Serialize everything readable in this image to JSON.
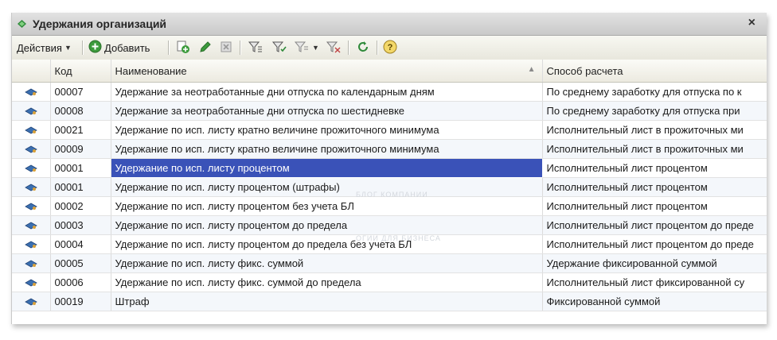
{
  "window": {
    "title": "Удержания организаций",
    "close_glyph": "×"
  },
  "toolbar": {
    "actions_label": "Действия",
    "add_label_first": "Д",
    "add_label_rest": "обавить",
    "icons": [
      "add-copy-icon",
      "edit-pencil-icon",
      "delete-icon",
      "filter-icon",
      "filter-by-value-icon",
      "filter-history-icon",
      "clear-filter-icon",
      "refresh-icon",
      "help-icon"
    ]
  },
  "table": {
    "columns": [
      "",
      "Код",
      "Наименование",
      "Способ расчета"
    ],
    "rows": [
      {
        "code": "00007",
        "name": "Удержание за неотработанные дни отпуска по календарным дням",
        "method": "По среднему заработку для отпуска по к"
      },
      {
        "code": "00008",
        "name": "Удержание за неотработанные дни отпуска по шестидневке",
        "method": "По среднему заработку для отпуска при"
      },
      {
        "code": "00021",
        "name": "Удержание по исп. листу кратно величине прожиточного минимума",
        "method": "Исполнительный лист в прожиточных ми"
      },
      {
        "code": "00009",
        "name": "Удержание по исп. листу кратно величине прожиточного минимума",
        "method": "Исполнительный лист в прожиточных ми"
      },
      {
        "code": "00001",
        "name": "Удержание по исп. листу процентом",
        "method": "Исполнительный лист процентом"
      },
      {
        "code": "00001",
        "name": "Удержание по исп. листу процентом (штрафы)",
        "method": "Исполнительный лист процентом"
      },
      {
        "code": "00002",
        "name": "Удержание по исп. листу процентом без учета БЛ",
        "method": "Исполнительный лист процентом"
      },
      {
        "code": "00003",
        "name": "Удержание по исп. листу процентом до предела",
        "method": "Исполнительный лист процентом до преде"
      },
      {
        "code": "00004",
        "name": "Удержание по исп. листу процентом до предела без учета БЛ",
        "method": "Исполнительный лист процентом до преде"
      },
      {
        "code": "00005",
        "name": "Удержание по исп. листу фикс. суммой",
        "method": "Удержание фиксированной суммой"
      },
      {
        "code": "00006",
        "name": "Удержание по исп. листу фикс. суммой до предела",
        "method": "Исполнительный лист фиксированной су"
      },
      {
        "code": "00019",
        "name": "Штраф",
        "method": "Фиксированной суммой"
      }
    ],
    "selected_index": 4
  },
  "watermark": {
    "line1": "БЛОГ КОМПАНИИ",
    "line2": "ОГИИ ДЛЯ БИЗНЕСА"
  },
  "colors": {
    "selection": "#3a52b8",
    "accent_green": "#2f8a3a",
    "row_icon_blue": "#3b6fb0"
  }
}
